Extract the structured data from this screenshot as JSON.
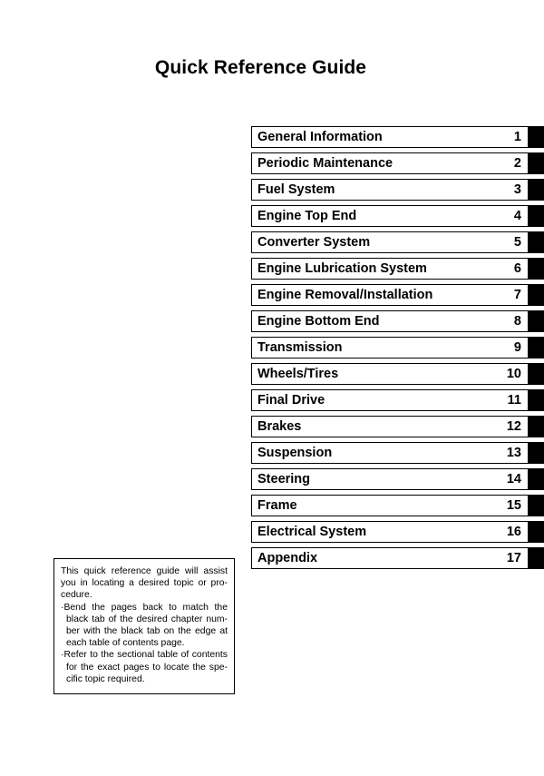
{
  "page": {
    "title": "Quick Reference Guide"
  },
  "chapter_index": {
    "rows": [
      {
        "name": "General Information",
        "number": "1"
      },
      {
        "name": "Periodic Maintenance",
        "number": "2"
      },
      {
        "name": "Fuel System",
        "number": "3"
      },
      {
        "name": "Engine Top End",
        "number": "4"
      },
      {
        "name": "Converter System",
        "number": "5"
      },
      {
        "name": "Engine Lubrication System",
        "number": "6"
      },
      {
        "name": "Engine Removal/Installation",
        "number": "7"
      },
      {
        "name": "Engine Bottom End",
        "number": "8"
      },
      {
        "name": "Transmission",
        "number": "9"
      },
      {
        "name": "Wheels/Tires",
        "number": "10"
      },
      {
        "name": "Final Drive",
        "number": "11"
      },
      {
        "name": "Brakes",
        "number": "12"
      },
      {
        "name": "Suspension",
        "number": "13"
      },
      {
        "name": "Steering",
        "number": "14"
      },
      {
        "name": "Frame",
        "number": "15"
      },
      {
        "name": "Electrical System",
        "number": "16"
      },
      {
        "name": "Appendix",
        "number": "17"
      }
    ]
  },
  "note": {
    "intro": "This quick reference guide will assist you in locating a desired topic or pro-cedure.",
    "bullets": [
      "Bend the pages back to match the black tab of the desired chapter num-ber with the black tab on the edge at each table of contents page.",
      "Refer to the sectional table of contents for the exact pages to locate the spe-cific topic required."
    ],
    "bullet_glyph": "·"
  }
}
